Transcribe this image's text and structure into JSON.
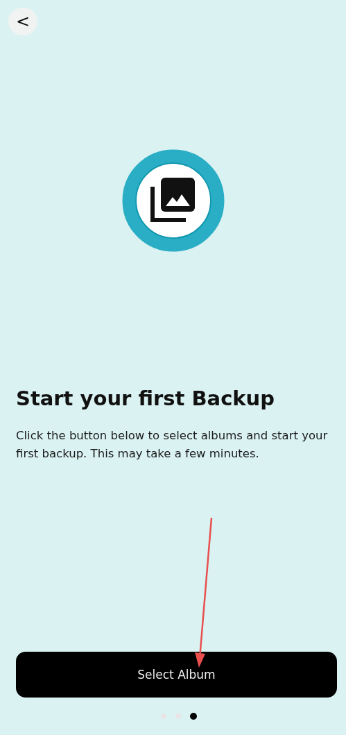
{
  "back_button": {
    "label": "<"
  },
  "title": "Start your first Backup",
  "description": "Click the button below to select albums and start your first backup. This may take a few minutes.",
  "primary_button": {
    "label": "Select Album"
  },
  "pager": [
    {
      "selected": false
    },
    {
      "selected": false
    },
    {
      "selected": true
    }
  ]
}
